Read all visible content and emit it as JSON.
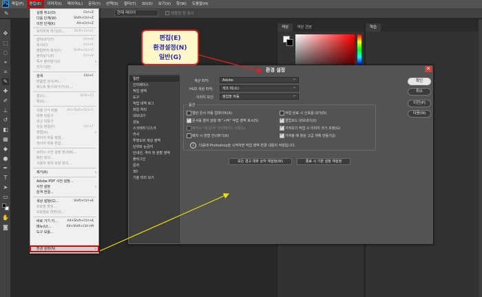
{
  "app_logo": "Ps",
  "menubar": {
    "items": [
      "파일(F)",
      "편집(E)",
      "이미지(I)",
      "레이어(L)",
      "문자(Y)",
      "선택(S)",
      "필터(T)",
      "3D(D)",
      "보기(V)",
      "창(W)",
      "도움말(H)"
    ]
  },
  "optbar": {
    "left_value": "샘플",
    "sample_select": "현재 레이어",
    "show_ring": "샘플링 링 표시"
  },
  "edit_menu": {
    "items": [
      {
        "label": "실행 취소(O)",
        "shortcut": "Ctrl+Z"
      },
      {
        "label": "다음 단계(W)",
        "shortcut": "Shift+Ctrl+Z"
      },
      {
        "label": "이전 단계(K)",
        "shortcut": "Alt+Ctrl+Z"
      },
      {
        "label": "희미하게 하기(D)...",
        "shortcut": "Shift+Ctrl+F"
      },
      {
        "label": "잘라내기(T)",
        "shortcut": "Ctrl+X"
      },
      {
        "label": "복사(C)",
        "shortcut": "Ctrl+C"
      },
      {
        "label": "병합하여 복사(Y)",
        "shortcut": "Shift+Ctrl+C"
      },
      {
        "label": "붙여넣기(P)",
        "shortcut": "Ctrl+V"
      },
      {
        "label": "특수 붙여넣기(I)",
        "shortcut": ""
      },
      {
        "label": "지우기(E)",
        "shortcut": ""
      },
      {
        "label": "검색",
        "shortcut": "Ctrl+F"
      },
      {
        "label": "맞춤법 검사(H)...",
        "shortcut": ""
      },
      {
        "label": "텍스트 찾기/바꾸기(X)...",
        "shortcut": ""
      },
      {
        "label": "칠(L)...",
        "shortcut": "Shift+F5"
      },
      {
        "label": "획(S)...",
        "shortcut": ""
      },
      {
        "label": "내용 인식 비율",
        "shortcut": "Alt+Shift+Ctrl+C"
      },
      {
        "label": "퍼펫 뒤틀기",
        "shortcut": ""
      },
      {
        "label": "원근 뒤틀기",
        "shortcut": ""
      },
      {
        "label": "자유 변형(F)",
        "shortcut": "Ctrl+T"
      },
      {
        "label": "변형(A)",
        "shortcut": ""
      },
      {
        "label": "레이어 자동 정렬...",
        "shortcut": ""
      },
      {
        "label": "레이어 자동 혼합...",
        "shortcut": ""
      },
      {
        "label": "브러시 사전 설정 정의(B)...",
        "shortcut": ""
      },
      {
        "label": "패턴 정의...",
        "shortcut": ""
      },
      {
        "label": "사용자 정의 모양 정의...",
        "shortcut": ""
      },
      {
        "label": "제거(R)",
        "shortcut": ""
      },
      {
        "label": "Adobe PDF 사전 설정...",
        "shortcut": ""
      },
      {
        "label": "사전 설정",
        "shortcut": ""
      },
      {
        "label": "원격 연결...",
        "shortcut": ""
      },
      {
        "label": "색상 설정(G)...",
        "shortcut": "Shift+Ctrl+K"
      },
      {
        "label": "프로필 할당...",
        "shortcut": ""
      },
      {
        "label": "프로필로 변환(V)...",
        "shortcut": ""
      },
      {
        "label": "바로 가기 키...",
        "shortcut": "Alt+Shift+Ctrl+K"
      },
      {
        "label": "메뉴(U)...",
        "shortcut": "Alt+Shift+Ctrl+M"
      },
      {
        "label": "도구 모음...",
        "shortcut": ""
      },
      {
        "label": "환경 설정(N)",
        "shortcut": ""
      }
    ]
  },
  "callout": {
    "line1": "편집(E)",
    "line2": "환경설정(N)",
    "line3": "일반(G)"
  },
  "panels": {
    "color_tab": "색상",
    "swatch_tab": "색상 견본",
    "learn_tab": "학습"
  },
  "prefs": {
    "title": "환경 설정",
    "nav": [
      "일반",
      "인터페이스",
      "작업 영역",
      "도구",
      "작업 내역 로그",
      "파일 처리",
      "내보내기",
      "성능",
      "스크래치 디스크",
      "커서",
      "투명도와 색상 영역",
      "단위와 눈금자",
      "안내선, 격자 및 분할 영역",
      "플러그인",
      "문자",
      "3D",
      "기술 미리 보기"
    ],
    "color_picker_label": "색상 피커:",
    "color_picker_value": "Adobe",
    "hud_label": "HUD 색상 피커:",
    "hud_value": "색조 띠(소)",
    "interp_label": "이미지 보간:",
    "interp_value": "쌍입방 자동",
    "options_legend": "옵션",
    "checks": {
      "auto_update": "열린 문서 자동 업데이트(A)",
      "beep": "작업 완료 시 신호음 내기(D)",
      "home_screen": "문서를 열지 않을 때 \"시작\" 작업 영역 표시(S)",
      "export_clipboard": "클립보드 내보내기(X)",
      "legacy_open": "레거시 \"새 문서\" 인터페이스 사용(L)",
      "resize_paste": "가져오기 작업 시 이미지 크기 조정(G)",
      "skip_transform": "배치 시 변형 건너뛰기(K)",
      "always_create": "가져올 때 항상 고급 개체 만들기(J)"
    },
    "info_text": "다음에 Photoshop을 시작하면 작업 영역 변경 내용이 적용됩니다.",
    "reset_warnings": "모든 경고 대화 상자 재설정(W)",
    "reset_on_quit": "종료 시 기본 설정 재설정",
    "buttons": [
      "확인",
      "취소",
      "이전(P)",
      "다음(N)"
    ]
  }
}
